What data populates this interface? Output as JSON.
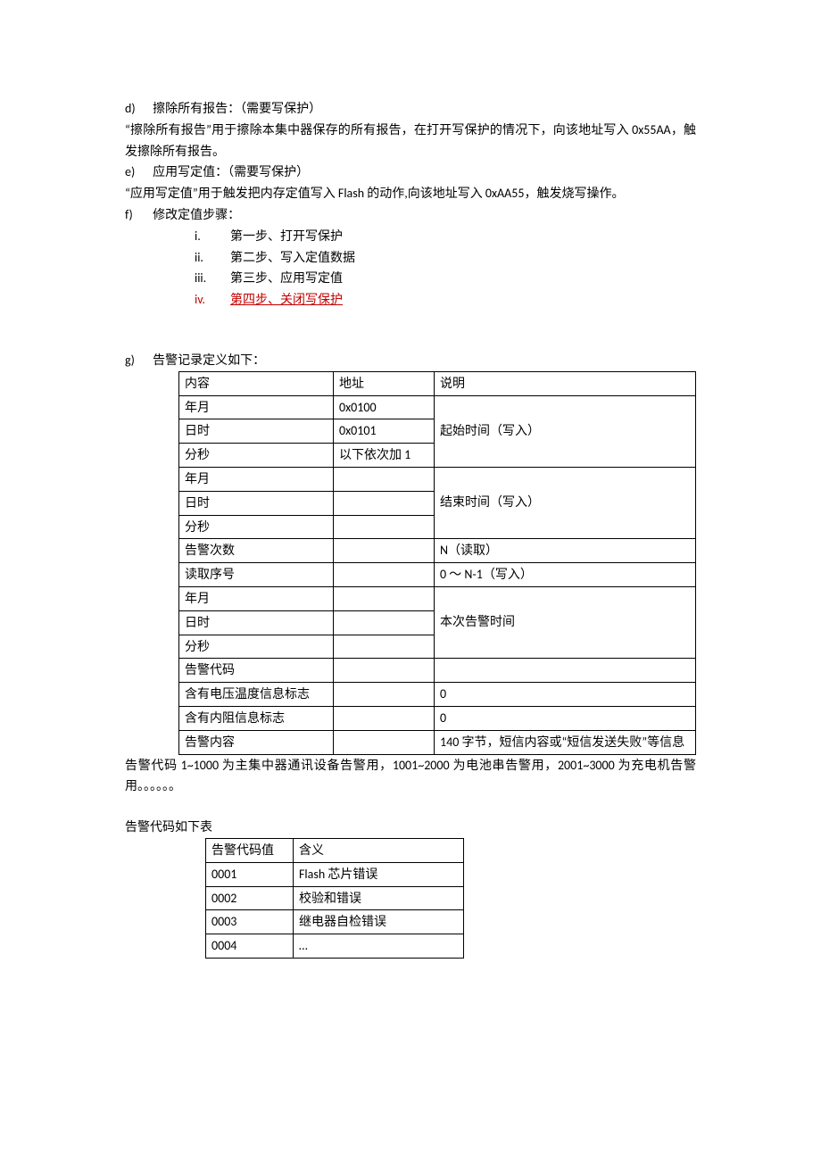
{
  "d": {
    "marker": "d)",
    "title": "擦除所有报告：（需要写保护）",
    "body": "“擦除所有报告”用于擦除本集中器保存的所有报告，在打开写保护的情况下，向该地址写入 0x55AA，触发擦除所有报告。"
  },
  "e": {
    "marker": "e)",
    "title": "应用写定值：（需要写保护）",
    "body": "“应用写定值”用于触发把内存定值写入 Flash 的动作,向该地址写入 0xAA55，触发烧写操作。"
  },
  "f": {
    "marker": "f)",
    "title": "修改定值步骤：",
    "steps": [
      {
        "m": "i.",
        "t": "第一步、打开写保护"
      },
      {
        "m": "ii.",
        "t": "第二步、写入定值数据"
      },
      {
        "m": "iii.",
        "t": "第三步、应用写定值"
      },
      {
        "m": "iv.",
        "t": "第四步、关闭写保护"
      }
    ]
  },
  "g": {
    "marker": "g)",
    "title": "告警记录定义如下：",
    "head": {
      "c1": "内容",
      "c2": "地址",
      "c3": "说明"
    },
    "rows": [
      {
        "c1": "年月",
        "c2": "0x0100",
        "c3": "",
        "border3": "b"
      },
      {
        "c1": "日时",
        "c2": "0x0101",
        "c3": "起始时间（写入）",
        "border3": "tb"
      },
      {
        "c1": "分秒",
        "c2": "以下依次加 1",
        "c3": "",
        "border3": "t"
      },
      {
        "c1": "年月",
        "c2": "",
        "c3": "",
        "border3": "b"
      },
      {
        "c1": "日时",
        "c2": "",
        "c3": "结束时间（写入）",
        "border3": "tb"
      },
      {
        "c1": "分秒",
        "c2": "",
        "c3": "",
        "border3": "t"
      },
      {
        "c1": "告警次数",
        "c2": "",
        "c3": "N（读取）"
      },
      {
        "c1": "读取序号",
        "c2": "",
        "c3": "0 ～ N-1（写入）"
      },
      {
        "c1": "年月",
        "c2": "",
        "c3": "",
        "border3": "b"
      },
      {
        "c1": "日时",
        "c2": "",
        "c3": "本次告警时间",
        "border3": "tb"
      },
      {
        "c1": "分秒",
        "c2": "",
        "c3": "",
        "border3": "t"
      },
      {
        "c1": "告警代码",
        "c2": "",
        "c3": ""
      },
      {
        "c1": "含有电压温度信息标志",
        "c2": "",
        "c3": "0"
      },
      {
        "c1": "含有内阻信息标志",
        "c2": "",
        "c3": "0"
      },
      {
        "c1": "告警内容",
        "c2": "",
        "c3": "140 字节，短信内容或“短信发送失败”等信息"
      }
    ],
    "note": "告警代码 1~1000 为主集中器通讯设备告警用，1001~2000 为电池串告警用，2001~3000 为充电机告警用。。。。。。",
    "table2title": "告警代码如下表",
    "t2head": {
      "c1": "告警代码值",
      "c2": "含义"
    },
    "t2rows": [
      {
        "c1": "0001",
        "c2": "Flash 芯片错误"
      },
      {
        "c1": "0002",
        "c2": "校验和错误"
      },
      {
        "c1": "0003",
        "c2": "继电器自检错误"
      },
      {
        "c1": "0004",
        "c2": "…"
      }
    ]
  }
}
